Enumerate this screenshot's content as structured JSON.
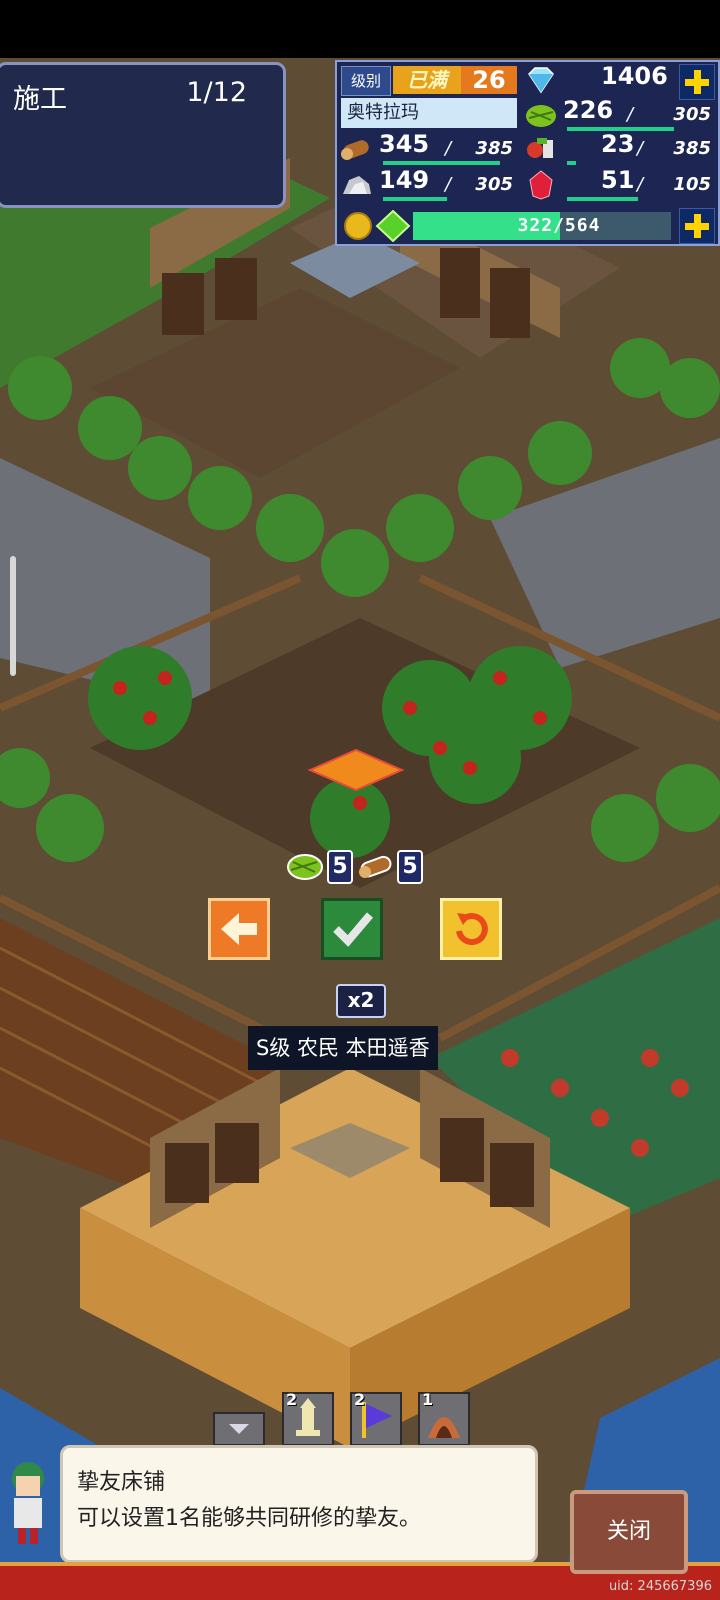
{
  "build": {
    "label": "施工",
    "progress": "1/12"
  },
  "status": {
    "rank_label": "级别",
    "rank_max": "已满",
    "rank_level": "26",
    "town_name": "奥特拉玛",
    "gems": "1406",
    "resources": [
      {
        "icon": "grass-icon",
        "value": "226",
        "max": "305",
        "fill": 0.74
      },
      {
        "icon": "wood-icon",
        "value": "345",
        "max": "385",
        "fill": 0.9
      },
      {
        "icon": "food-icon",
        "value": "23",
        "max": "385",
        "fill": 0.06
      },
      {
        "icon": "ore-icon",
        "value": "149",
        "max": "305",
        "fill": 0.49
      },
      {
        "icon": "ruby-icon",
        "value": "51",
        "max": "105",
        "fill": 0.49
      }
    ],
    "exp_text": "322/564",
    "exp_fill": 0.571
  },
  "placement": {
    "costs": [
      {
        "icon": "grass-icon",
        "value": "5"
      },
      {
        "icon": "wood-icon",
        "value": "5"
      }
    ],
    "multiplier": "x2",
    "worker_label": "S级 农民  本田遥香"
  },
  "tray": {
    "counts": [
      "2",
      "2",
      "1"
    ]
  },
  "hint": {
    "title": "挚友床铺",
    "desc": "可以设置1名能够共同研修的挚友。"
  },
  "close_label": "关闭",
  "uid": "uid: 245667396",
  "colors": {
    "accent_panel": "#1d2652",
    "exp_bar": "#34e08a",
    "close_button": "#8a4a3a",
    "bottom_bar": "#b8231b"
  }
}
